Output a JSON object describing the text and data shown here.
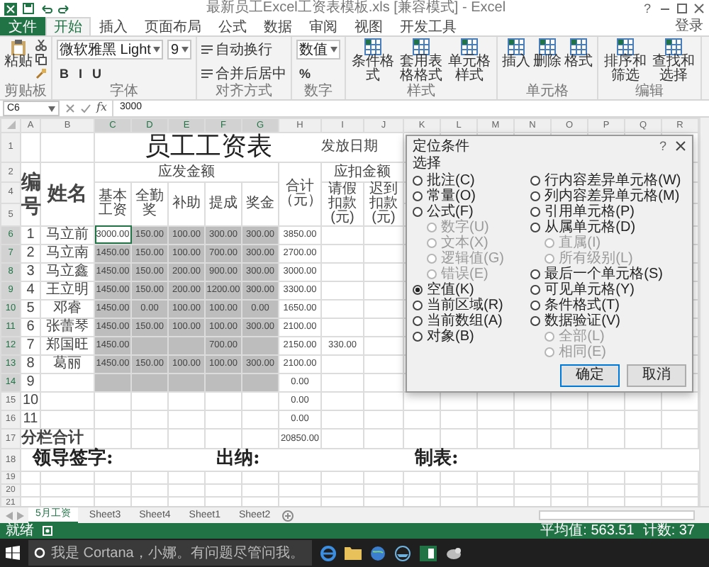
{
  "window": {
    "title": "最新员工Excel工资表模板.xls [兼容模式] - Excel",
    "help": "?"
  },
  "ribbon": {
    "tabs": [
      {
        "label": "文件",
        "kind": "file",
        "selected": false
      },
      {
        "label": "开始",
        "kind": "tab",
        "selected": true
      },
      {
        "label": "插入",
        "kind": "tab",
        "selected": false
      },
      {
        "label": "页面布局",
        "kind": "tab",
        "selected": false
      },
      {
        "label": "公式",
        "kind": "tab",
        "selected": false
      },
      {
        "label": "数据",
        "kind": "tab",
        "selected": false
      },
      {
        "label": "审阅",
        "kind": "tab",
        "selected": false
      },
      {
        "label": "视图",
        "kind": "tab",
        "selected": false
      },
      {
        "label": "开发工具",
        "kind": "tab",
        "selected": false
      }
    ],
    "account": "登录",
    "groups": [
      {
        "label": "剪贴板",
        "kind": "clipboard",
        "items": [
          {
            "kind": "paste",
            "label": "粘贴"
          }
        ]
      },
      {
        "label": "字体",
        "kind": "lines",
        "lines": [
          [
            {
              "kind": "combo",
              "label": "微软雅黑 Light"
            },
            {
              "kind": "combo",
              "label": "9"
            }
          ],
          [
            {
              "kind": "toggle",
              "label": "B"
            },
            {
              "kind": "toggle",
              "label": "I"
            },
            {
              "kind": "toggle",
              "label": "U"
            }
          ]
        ]
      },
      {
        "label": "对齐方式",
        "kind": "lines",
        "lines": [
          [
            {
              "kind": "button",
              "label": "自动换行"
            }
          ],
          [
            {
              "kind": "button",
              "label": "合并后居中"
            }
          ]
        ]
      },
      {
        "label": "数字",
        "kind": "lines",
        "lines": [
          [
            {
              "kind": "combo",
              "label": "数值"
            }
          ],
          [
            {
              "kind": "toggle",
              "label": "%"
            }
          ]
        ]
      },
      {
        "label": "样式",
        "kind": "big",
        "items": [
          {
            "kind": "big",
            "label": "条件格式"
          },
          {
            "kind": "big",
            "label": "套用表格格式"
          },
          {
            "kind": "big",
            "label": "单元格样式"
          }
        ]
      },
      {
        "label": "单元格",
        "kind": "big",
        "items": [
          {
            "kind": "big",
            "label": "插入"
          },
          {
            "kind": "big",
            "label": "删除"
          },
          {
            "kind": "big",
            "label": "格式"
          }
        ]
      },
      {
        "label": "编辑",
        "kind": "big",
        "items": [
          {
            "kind": "big",
            "label": "排序和筛选"
          },
          {
            "kind": "big",
            "label": "查找和选择"
          }
        ]
      }
    ]
  },
  "formula_bar": {
    "name_box": "C6",
    "fx": "fx",
    "value": "3000"
  },
  "sheet": {
    "columns": [
      {
        "label": "A",
        "selected": false
      },
      {
        "label": "B",
        "selected": false
      },
      {
        "label": "C",
        "selected": true
      },
      {
        "label": "D",
        "selected": true
      },
      {
        "label": "E",
        "selected": true
      },
      {
        "label": "F",
        "selected": true
      },
      {
        "label": "G",
        "selected": true
      },
      {
        "label": "H",
        "selected": false
      },
      {
        "label": "I",
        "selected": false
      },
      {
        "label": "J",
        "selected": false
      },
      {
        "label": "K",
        "selected": false
      },
      {
        "label": "L",
        "selected": false
      },
      {
        "label": "M",
        "selected": false
      },
      {
        "label": "N",
        "selected": false
      },
      {
        "label": "O",
        "selected": false
      },
      {
        "label": "P",
        "selected": false
      },
      {
        "label": "Q",
        "selected": false
      },
      {
        "label": "R",
        "selected": false
      }
    ],
    "title_row": {
      "row_number": "1",
      "title": "员工工资表",
      "date_label": "发放日期"
    },
    "group_row": {
      "row_number": "2",
      "earnings": "应发金额",
      "deductions": "应扣金额"
    },
    "header_rows": {
      "row_numbers": [
        "4",
        "5"
      ],
      "number": "编号",
      "name": "姓名",
      "amounts": [
        "基本工资",
        "全勤奖",
        "补助",
        "提成",
        "奖金"
      ],
      "total": "合计（元）",
      "deductions": [
        "请假扣款(元)",
        "迟到扣款(元)"
      ]
    },
    "rows": [
      {
        "row_number": "6",
        "number": "1",
        "name": "马立前",
        "selected": true,
        "amounts": [
          {
            "value": "3000.00",
            "active": true
          },
          {
            "value": "150.00",
            "active": false
          },
          {
            "value": "100.00",
            "active": false
          },
          {
            "value": "300.00",
            "active": false
          },
          {
            "value": "300.00",
            "active": false
          }
        ],
        "total": "3850.00"
      },
      {
        "row_number": "7",
        "number": "2",
        "name": "马立南",
        "selected": true,
        "amounts": [
          {
            "value": "1450.00",
            "active": false
          },
          {
            "value": "150.00",
            "active": false
          },
          {
            "value": "100.00",
            "active": false
          },
          {
            "value": "700.00",
            "active": false
          },
          {
            "value": "300.00",
            "active": false
          }
        ],
        "total": "2700.00"
      },
      {
        "row_number": "8",
        "number": "3",
        "name": "马立鑫",
        "selected": true,
        "amounts": [
          {
            "value": "1450.00",
            "active": false
          },
          {
            "value": "150.00",
            "active": false
          },
          {
            "value": "200.00",
            "active": false
          },
          {
            "value": "900.00",
            "active": false
          },
          {
            "value": "300.00",
            "active": false
          }
        ],
        "total": "3000.00"
      },
      {
        "row_number": "9",
        "number": "4",
        "name": "王立明",
        "selected": true,
        "amounts": [
          {
            "value": "1450.00",
            "active": false
          },
          {
            "value": "150.00",
            "active": false
          },
          {
            "value": "200.00",
            "active": false
          },
          {
            "value": "1200.00",
            "active": false
          },
          {
            "value": "300.00",
            "active": false
          }
        ],
        "total": "3300.00"
      },
      {
        "row_number": "10",
        "number": "5",
        "name": "邓睿",
        "selected": true,
        "amounts": [
          {
            "value": "1450.00",
            "active": false
          },
          {
            "value": "0.00",
            "active": false
          },
          {
            "value": "100.00",
            "active": false
          },
          {
            "value": "100.00",
            "active": false
          },
          {
            "value": "0.00",
            "active": false
          }
        ],
        "total": "1650.00"
      },
      {
        "row_number": "11",
        "number": "6",
        "name": "张蕾琴",
        "selected": true,
        "amounts": [
          {
            "value": "1450.00",
            "active": false
          },
          {
            "value": "150.00",
            "active": false
          },
          {
            "value": "100.00",
            "active": false
          },
          {
            "value": "100.00",
            "active": false
          },
          {
            "value": "300.00",
            "active": false
          }
        ],
        "total": "2100.00"
      },
      {
        "row_number": "12",
        "number": "7",
        "name": "郑国旺",
        "selected": true,
        "amounts": [
          {
            "value": "1450.00",
            "active": false
          },
          {
            "active": false
          },
          {
            "active": false
          },
          {
            "value": "700.00",
            "active": false
          },
          {
            "active": false
          }
        ],
        "total": "2150.00",
        "deduction": "330.00"
      },
      {
        "row_number": "13",
        "number": "8",
        "name": "葛丽",
        "selected": true,
        "amounts": [
          {
            "value": "1450.00",
            "active": false
          },
          {
            "value": "150.00",
            "active": false
          },
          {
            "value": "100.00",
            "active": false
          },
          {
            "value": "100.00",
            "active": false
          },
          {
            "value": "300.00",
            "active": false
          }
        ],
        "total": "2100.00"
      },
      {
        "row_number": "14",
        "number": "9",
        "selected": true,
        "amounts": [
          {
            "active": false
          },
          {
            "active": false
          },
          {
            "active": false
          },
          {
            "active": false
          },
          {
            "active": false
          }
        ],
        "total": "0.00"
      },
      {
        "row_number": "15",
        "number": "10",
        "selected": false,
        "amounts": [
          {
            "active": false
          },
          {
            "active": false
          },
          {
            "active": false
          },
          {
            "active": false
          },
          {
            "active": false
          }
        ],
        "total": "0.00"
      },
      {
        "row_number": "16",
        "number": "11",
        "selected": false,
        "amounts": [
          {
            "active": false
          },
          {
            "active": false
          },
          {
            "active": false
          },
          {
            "active": false
          },
          {
            "active": false
          }
        ],
        "total": "0.00"
      }
    ],
    "sum_row": {
      "row_number": "17",
      "label": "分栏合计",
      "total": "20850.00"
    },
    "footer_row": {
      "row_number": "18",
      "signatures": [
        "领导签字:",
        "出纳:",
        "制表:"
      ]
    },
    "empty_rows": [
      "19",
      "20",
      "21"
    ]
  },
  "dialog": {
    "title": "定位条件",
    "help": "?",
    "section": "选择",
    "left": [
      {
        "kind": "radio",
        "label": "批注(C)",
        "selected": false,
        "disabled": false
      },
      {
        "kind": "radio",
        "label": "常量(O)",
        "selected": false,
        "disabled": false
      },
      {
        "kind": "radio",
        "label": "公式(F)",
        "selected": false,
        "disabled": false
      },
      {
        "kind": "sub",
        "label": "数字(U)",
        "selected": false,
        "disabled": true
      },
      {
        "kind": "sub",
        "label": "文本(X)",
        "selected": false,
        "disabled": true
      },
      {
        "kind": "sub",
        "label": "逻辑值(G)",
        "selected": false,
        "disabled": true
      },
      {
        "kind": "sub",
        "label": "错误(E)",
        "selected": false,
        "disabled": true
      },
      {
        "kind": "radio",
        "label": "空值(K)",
        "selected": true,
        "disabled": false
      },
      {
        "kind": "radio",
        "label": "当前区域(R)",
        "selected": false,
        "disabled": false
      },
      {
        "kind": "radio",
        "label": "当前数组(A)",
        "selected": false,
        "disabled": false
      },
      {
        "kind": "radio",
        "label": "对象(B)",
        "selected": false,
        "disabled": false
      }
    ],
    "right": [
      {
        "kind": "radio",
        "label": "行内容差异单元格(W)",
        "selected": false,
        "disabled": false
      },
      {
        "kind": "radio",
        "label": "列内容差异单元格(M)",
        "selected": false,
        "disabled": false
      },
      {
        "kind": "radio",
        "label": "引用单元格(P)",
        "selected": false,
        "disabled": false
      },
      {
        "kind": "radio",
        "label": "从属单元格(D)",
        "selected": false,
        "disabled": false
      },
      {
        "kind": "sub",
        "label": "直属(I)",
        "selected": false,
        "disabled": true
      },
      {
        "kind": "sub",
        "label": "所有级别(L)",
        "selected": false,
        "disabled": true
      },
      {
        "kind": "radio",
        "label": "最后一个单元格(S)",
        "selected": false,
        "disabled": false
      },
      {
        "kind": "radio",
        "label": "可见单元格(Y)",
        "selected": false,
        "disabled": false
      },
      {
        "kind": "radio",
        "label": "条件格式(T)",
        "selected": false,
        "disabled": false
      },
      {
        "kind": "radio",
        "label": "数据验证(V)",
        "selected": false,
        "disabled": false
      },
      {
        "kind": "sub",
        "label": "全部(L)",
        "selected": false,
        "disabled": true
      },
      {
        "kind": "sub",
        "label": "相同(E)",
        "selected": false,
        "disabled": true
      }
    ],
    "buttons": [
      {
        "label": "确定",
        "default": true
      },
      {
        "label": "取消",
        "default": false
      }
    ]
  },
  "sheet_tabs": [
    {
      "label": "5月工资",
      "selected": true
    },
    {
      "label": "Sheet3",
      "selected": false
    },
    {
      "label": "Sheet4",
      "selected": false
    },
    {
      "label": "Sheet1",
      "selected": false
    },
    {
      "label": "Sheet2",
      "selected": false
    }
  ],
  "status_bar": {
    "mode": "就绪",
    "average": "平均值: 563.51",
    "count": "计数: 37"
  },
  "taskbar": {
    "search_placeholder": "我是 Cortana，小娜。有问题尽管问我。"
  }
}
